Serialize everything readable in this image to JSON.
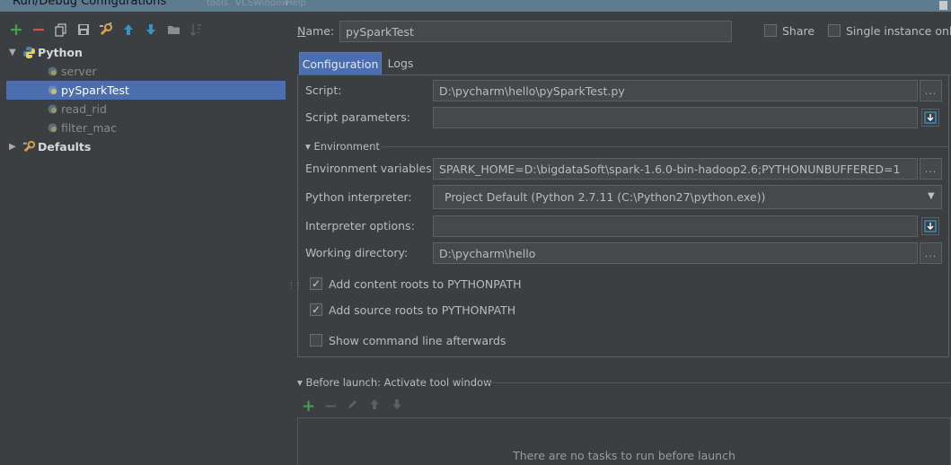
{
  "window": {
    "title": "Run/Debug Configurations",
    "ghost_menu": [
      "tools",
      "VCS",
      "Window",
      "Help"
    ]
  },
  "toolbar": {
    "add": "+",
    "remove": "−",
    "items": [
      "add-icon",
      "remove-icon",
      "copy-icon",
      "save-icon",
      "wrench-icon",
      "move-up-icon",
      "move-down-icon",
      "folder-icon",
      "sort-icon"
    ]
  },
  "tree": {
    "python_group": "Python",
    "items": [
      "server",
      "pySparkTest",
      "read_rid",
      "filter_mac"
    ],
    "defaults_group": "Defaults"
  },
  "name": {
    "label": "Name:",
    "value": "pySparkTest"
  },
  "share": {
    "label": "Share",
    "checked": false
  },
  "single_instance": {
    "label": "Single instance only",
    "checked": false
  },
  "tabs": [
    "Configuration",
    "Logs"
  ],
  "form": {
    "script_label": "Script:",
    "script_value": "D:\\pycharm\\hello\\pySparkTest.py",
    "params_label": "Script parameters:",
    "params_value": "",
    "environment_section": "Environment",
    "env_vars_label": "Environment variables:",
    "env_vars_value": "SPARK_HOME=D:\\bigdataSoft\\spark-1.6.0-bin-hadoop2.6;PYTHONUNBUFFERED=1",
    "interpreter_label": "Python interpreter:",
    "interpreter_value": "Project Default (Python 2.7.11 (C:\\Python27\\python.exe))",
    "interp_options_label": "Interpreter options:",
    "interp_options_value": "",
    "workdir_label": "Working directory:",
    "workdir_value": "D:\\pycharm\\hello",
    "ellipsis": "..."
  },
  "checkboxes": {
    "content_roots": {
      "label": "Add content roots to PYTHONPATH",
      "checked": true
    },
    "source_roots": {
      "label": "Add source roots to PYTHONPATH",
      "checked": true
    },
    "show_cmdline": {
      "label": "Show command line afterwards",
      "checked": false
    }
  },
  "before_launch": {
    "title": "Before launch: Activate tool window",
    "empty_message": "There are no tasks to run before launch"
  },
  "colors": {
    "selection": "#4b6eaf",
    "add_green": "#499c54",
    "remove_red": "#c75450",
    "arrow_blue": "#3592c4"
  }
}
